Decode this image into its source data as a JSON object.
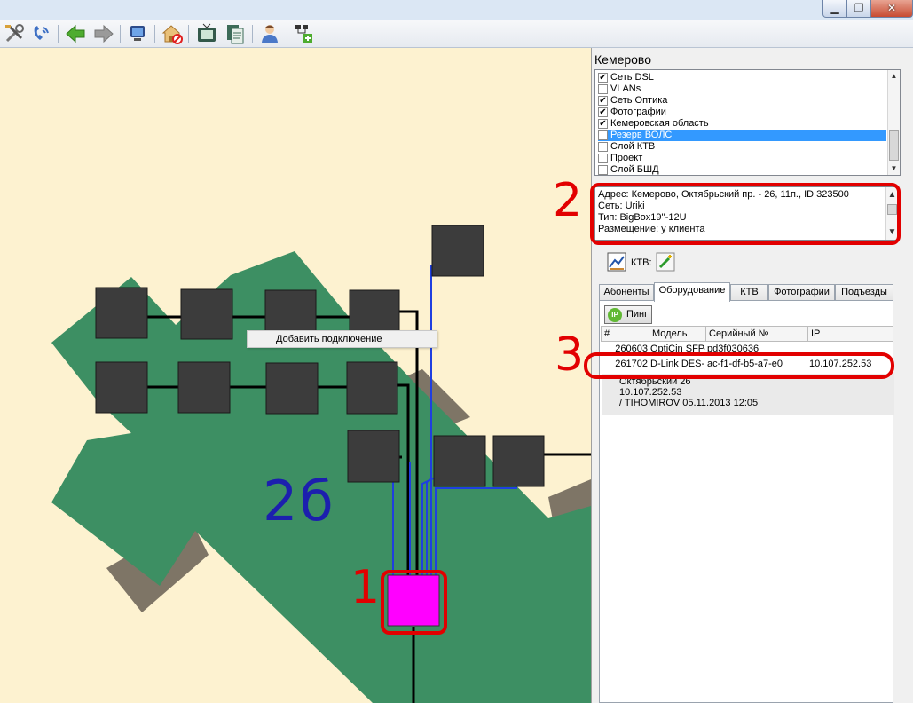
{
  "window": {
    "buttons": {
      "minimize": "▁",
      "maximize": "❐",
      "close": "✕"
    }
  },
  "toolbar": {
    "icons": [
      "tools-icon",
      "handset-icon",
      "back-arrow-icon",
      "forward-arrow-icon",
      "monitor-icon",
      "home-disabled-icon",
      "tv-set-icon",
      "documents-icon",
      "user-icon",
      "network-add-icon"
    ]
  },
  "map": {
    "context_menu": "Добавить подключение",
    "building_label": "2б",
    "annotations": {
      "a1": "1",
      "a2": "2",
      "a3": "3"
    }
  },
  "panel": {
    "region": "Кемерово",
    "layers": [
      {
        "label": "Сеть DSL",
        "checked": true,
        "check_mark": "✔",
        "selected": false
      },
      {
        "label": "VLANs",
        "checked": false,
        "check_mark": "",
        "selected": false
      },
      {
        "label": "Сеть Оптика",
        "checked": true,
        "check_mark": "✔",
        "selected": false
      },
      {
        "label": "Фотографии",
        "checked": true,
        "check_mark": "✔",
        "selected": false
      },
      {
        "label": "Кемеровская область",
        "checked": true,
        "check_mark": "✔",
        "selected": false
      },
      {
        "label": "Резерв ВОЛС",
        "checked": false,
        "check_mark": "",
        "selected": true
      },
      {
        "label": "Слой КТВ",
        "checked": false,
        "check_mark": "",
        "selected": false
      },
      {
        "label": "Проект",
        "checked": false,
        "check_mark": "",
        "selected": false
      },
      {
        "label": "Слой БШД",
        "checked": false,
        "check_mark": "",
        "selected": false
      }
    ],
    "info": {
      "address": "Адрес:  Кемерово, Октябрьский пр. - 26, 11п., ID 323500",
      "network": "Сеть:  Uriki",
      "type": "Тип:  BigBox19''-12U",
      "placement": "Размещение:  у клиента"
    },
    "ktv_label": "КТВ:",
    "tabs": [
      "Абоненты",
      "Оборудование",
      "КТВ",
      "Фотографии",
      "Подъезды"
    ],
    "active_tab": "Оборудование",
    "ping_label": "Пинг",
    "ping_icon_text": "IP",
    "table": {
      "columns": [
        "#",
        "Модель",
        "Серийный №",
        "IP"
      ],
      "rows": [
        {
          "id": "260603",
          "model": "OptiCin SFP-",
          "serial": "pd3f030636",
          "ip": ""
        },
        {
          "id": "261702",
          "model": "D-Link DES-",
          "serial": "ac-f1-df-b5-a7-e0",
          "ip": "10.107.252.53"
        }
      ],
      "detail": [
        "Октябрьский 26",
        "10.107.252.53",
        " / TIHOMIROV 05.11.2013 12:05"
      ]
    }
  }
}
